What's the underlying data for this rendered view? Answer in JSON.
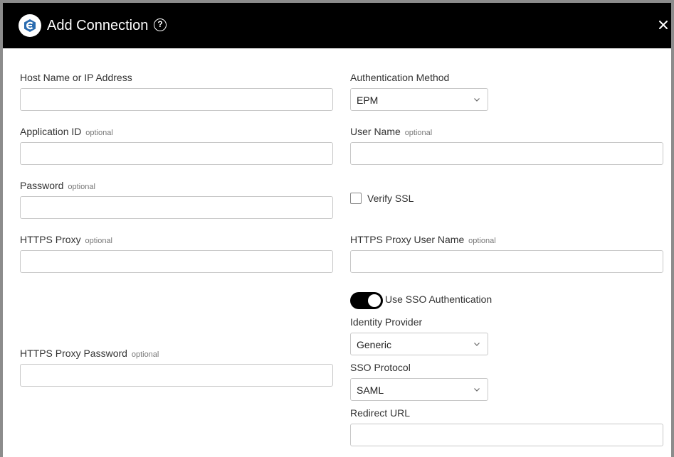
{
  "dialog": {
    "title": "Add Connection",
    "help_icon": "question-circle-icon",
    "close_icon": "close-icon",
    "logo_icon": "app-logo-icon"
  },
  "optional_text": "optional",
  "fields": {
    "host": {
      "label": "Host Name or IP Address",
      "value": ""
    },
    "auth_method": {
      "label": "Authentication Method",
      "value": "EPM"
    },
    "application_id": {
      "label": "Application ID",
      "value": ""
    },
    "user_name": {
      "label": "User Name",
      "value": ""
    },
    "password": {
      "label": "Password",
      "value": ""
    },
    "verify_ssl": {
      "label": "Verify SSL",
      "checked": false
    },
    "https_proxy": {
      "label": "HTTPS Proxy",
      "value": ""
    },
    "https_proxy_user": {
      "label": "HTTPS Proxy User Name",
      "value": ""
    },
    "use_sso": {
      "label": "Use SSO Authentication",
      "on": true
    },
    "identity_provider": {
      "label": "Identity Provider",
      "value": "Generic"
    },
    "https_proxy_password": {
      "label": "HTTPS Proxy Password",
      "value": ""
    },
    "sso_protocol": {
      "label": "SSO Protocol",
      "value": "SAML"
    },
    "redirect_url": {
      "label": "Redirect URL",
      "value": ""
    }
  },
  "colors": {
    "header_bg": "#000000",
    "logo_blue": "#2b6cb0",
    "toggle_on": "#000000"
  }
}
